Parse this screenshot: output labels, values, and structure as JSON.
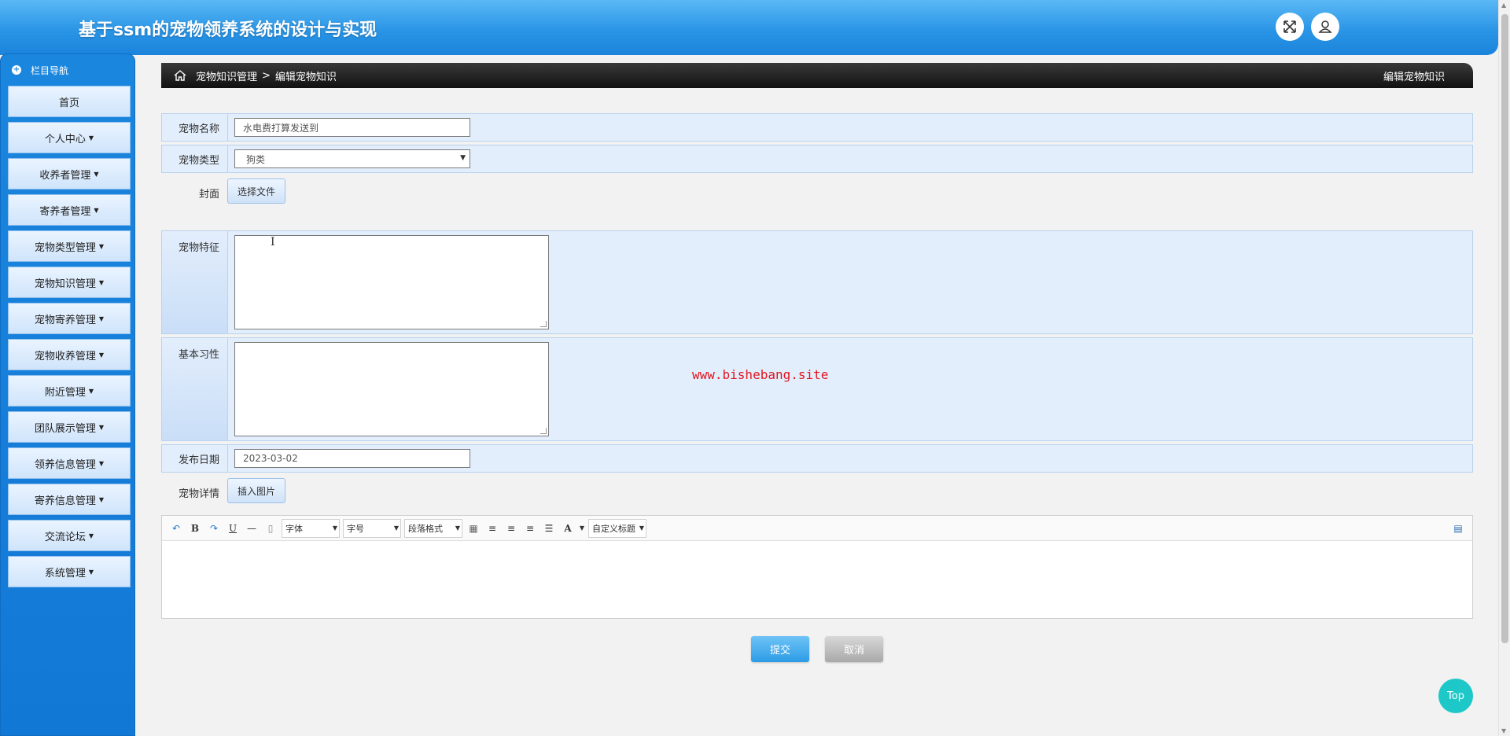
{
  "header": {
    "title": "基于ssm的宠物领养系统的设计与实现",
    "fullscreen_icon": "expand-arrows-icon",
    "user_icon": "user-icon"
  },
  "sidebar": {
    "title": "栏目导航",
    "items": [
      {
        "label": "首页",
        "dropdown": false
      },
      {
        "label": "个人中心",
        "dropdown": true
      },
      {
        "label": "收养者管理",
        "dropdown": true
      },
      {
        "label": "寄养者管理",
        "dropdown": true
      },
      {
        "label": "宠物类型管理",
        "dropdown": true
      },
      {
        "label": "宠物知识管理",
        "dropdown": true
      },
      {
        "label": "宠物寄养管理",
        "dropdown": true
      },
      {
        "label": "宠物收养管理",
        "dropdown": true
      },
      {
        "label": "附近管理",
        "dropdown": true
      },
      {
        "label": "团队展示管理",
        "dropdown": true
      },
      {
        "label": "领养信息管理",
        "dropdown": true
      },
      {
        "label": "寄养信息管理",
        "dropdown": true
      },
      {
        "label": "交流论坛",
        "dropdown": true
      },
      {
        "label": "系统管理",
        "dropdown": true
      }
    ]
  },
  "breadcrumb": {
    "parent": "宠物知识管理",
    "separator": ">",
    "current": "编辑宠物知识",
    "right_title": "编辑宠物知识"
  },
  "form": {
    "pet_name": {
      "label": "宠物名称",
      "value": "水电费打算发送到"
    },
    "pet_type": {
      "label": "宠物类型",
      "value": "狗类"
    },
    "cover": {
      "label": "封面",
      "button": "选择文件"
    },
    "features": {
      "label": "宠物特征",
      "value": ""
    },
    "habits": {
      "label": "基本习性",
      "value": ""
    },
    "publish_date": {
      "label": "发布日期",
      "value": "2023-03-02"
    },
    "details": {
      "label": "宠物详情",
      "button": "插入图片"
    }
  },
  "editor": {
    "font_select": "字体",
    "size_select": "字号",
    "paragraph_select": "段落格式",
    "custom_title_select": "自定义标题"
  },
  "actions": {
    "submit": "提交",
    "cancel": "取消"
  },
  "watermark": "www.bishebang.site",
  "back_to_top": "Top"
}
